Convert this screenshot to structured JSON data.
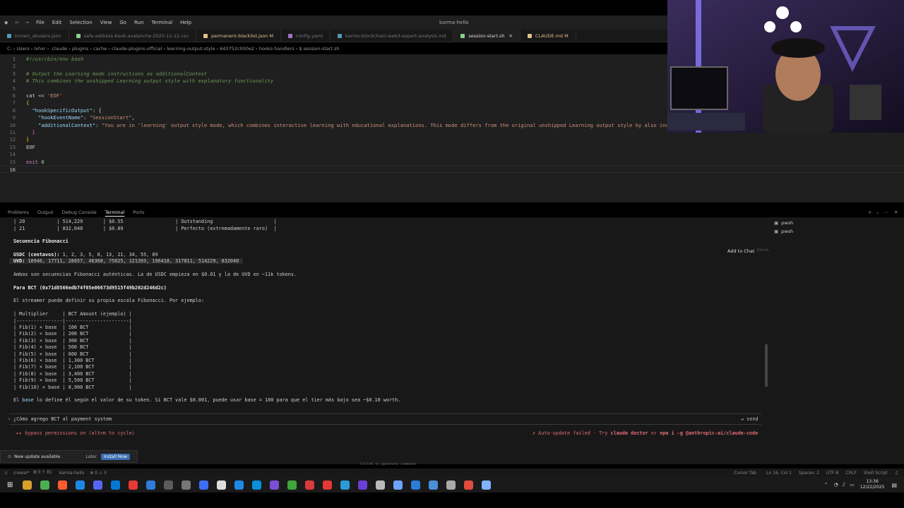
{
  "window": {
    "title": "karma-hello",
    "menu": [
      "File",
      "Edit",
      "Selection",
      "View",
      "Go",
      "Run",
      "Terminal",
      "Help"
    ]
  },
  "tabs": [
    {
      "label": "known_abusers.json",
      "color": "#519aba"
    },
    {
      "label": "safe-address-book-avalanche-2025-12-12.csv",
      "color": "#89d185"
    },
    {
      "label": "permanent-blacklist.json M",
      "color": "#e2c08d"
    },
    {
      "label": "config.yaml",
      "color": "#a074c4"
    },
    {
      "label": "karmo-blockchain-web3-expert-analysis.md",
      "color": "#519aba"
    },
    {
      "label": "session-start.sh",
      "color": "#89d185",
      "active": true
    },
    {
      "label": "CLAUDE.md M",
      "color": "#e2c08d"
    }
  ],
  "breadcrumb": "C: › Users › lxhxr › .claude › plugins › cache › claude-plugins-official › learning-output-style › 6d3752c000e2 › hooks-handlers › $ session-start.sh",
  "code": {
    "l1": "#!/usr/bin/env bash",
    "l3": "# Output the Learning mode instructions as additionalContext",
    "l4": "# This combines the unshipped Learning output style with explanatory functionality",
    "l6a": "cat",
    "l6b": " << ",
    "l6c": "'EOF'",
    "l7": "{",
    "l8a": "  \"hookSpecificOutput\"",
    "l8b": ": {",
    "l9a": "    \"hookEventName\"",
    "l9b": ": ",
    "l9c": "\"SessionStart\"",
    "l9d": ",",
    "l10a": "    \"additionalContext\"",
    "l10b": ": ",
    "l10c": "\"You are in 'learning' output style mode, which combines interactive learning with educational explanations. This mode differs from the original unshipped Learning output style by also incorp",
    "l11": "  }",
    "l12": "}",
    "l13": "EOF",
    "l15a": "exit",
    "l15b": " 0"
  },
  "panel": {
    "tabs": [
      "Problems",
      "Output",
      "Debug Console",
      "Terminal",
      "Ports"
    ],
    "active": "Terminal"
  },
  "terminal": {
    "r20": "| 20           | 514,229       | $0.55                  | Outstanding                     |",
    "r21": "| 21           | 832,040       | $0.89                  | Perfecto (extremadamente raro)  |",
    "fib_title": "Secuencia Fibonacci",
    "usdc_label": "USDC (centavos):",
    "usdc": " 1, 2, 3, 5, 8, 13, 21, 34, 55, 89",
    "uvd_label": "UVD:",
    "uvd": " 10946, 17711, 28657, 46368, 75025, 121393, 196418, 317811, 514229, 832040",
    "ambas": "Ambas son secuencias Fibonacci auténticas. La de USDC empieza en $0.01 y la de UVD en ~11k tokens.",
    "bct_title": "Para BCT (0x71d8566edb74f05e06673d9515f49b202d246d2c)",
    "streamer": "El streamer puede definir su propia escala Fibonacci. Por ejemplo:",
    "table_header": "| Multiplier     | BCT Amount (ejemplo) |",
    "table_sep": "|----------------|----------------------|",
    "rows": [
      "| Fib(1) × base  | 100 BCT              |",
      "| Fib(2) × base  | 200 BCT              |",
      "| Fib(3) × base  | 300 BCT              |",
      "| Fib(4) × base  | 500 BCT              |",
      "| Fib(5) × base  | 800 BCT              |",
      "| Fib(6) × base  | 1,300 BCT            |",
      "| Fib(7) × base  | 2,100 BCT            |",
      "| Fib(8) × base  | 3,400 BCT            |",
      "| Fib(9) × base  | 5,500 BCT            |",
      "| Fib(10) × base | 8,900 BCT            |"
    ],
    "base_a": "El ",
    "base_b": "base",
    "base_c": " lo define él según el valor de su token. Si BCT vale $0.001, puede usar base = 100 para que el tier más bajo sea ~$0.10 worth.",
    "prompt": "¿Cómo agrego BCT al payment system",
    "send": "↵ send",
    "bypass": "▸▸ bypass permissions on (alt+m to cycle)",
    "autoupdate_a": "✗ Auto-update failed · Try ",
    "autoupdate_b": "claude doctor",
    "autoupdate_c": " or ",
    "autoupdate_d": "npm i -g @anthropic-ai/claude-code",
    "generate_hint": "Ctrl+K to generate command"
  },
  "terminal_list": [
    "pwsh",
    "pwsh"
  ],
  "add_to_chat": "Add to Chat",
  "add_to_chat_key": "Ctrl+L",
  "update": {
    "text": "New update available",
    "later": "Later",
    "install": "Install Now"
  },
  "status": {
    "left": [
      "crewai*",
      "⧉ 0 ↑ 81",
      "karma-hello",
      "⊗ 0 ⚠ 0"
    ],
    "right": [
      "Cursor Tab",
      "Ln 16, Col 1",
      "Spaces: 2",
      "UTF-8",
      "CRLF",
      "Shell Script"
    ]
  },
  "clock": {
    "time": "13:36",
    "date": "12/22/2025"
  },
  "taskbar_colors": [
    "#d8a12a",
    "#4caf50",
    "#ff5b2e",
    "#1e88e5",
    "#5865f2",
    "#0078d4",
    "#e53935",
    "#2f7bd8",
    "#5b5b5b",
    "#777777",
    "#3b6ef5",
    "#dddddd",
    "#1e88e5",
    "#0a8fd8",
    "#7a4fd4",
    "#3ea63a",
    "#d83b3b",
    "#e53935",
    "#2a9bd8",
    "#6b3fd4",
    "#bbbbbb",
    "#6fa3ff",
    "#2b7bd8",
    "#4a8fd8",
    "#aaaaaa",
    "#e04a3f",
    "#7fb3ff"
  ]
}
